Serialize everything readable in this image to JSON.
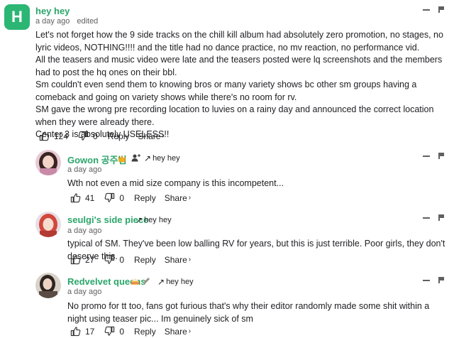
{
  "colors": {
    "avatar_green": "#2bb673",
    "author_green": "#2ba66a",
    "muted": "#606060"
  },
  "comments": [
    {
      "avatar_letter": "H",
      "author": "hey hey",
      "time": "a day ago",
      "edited": "edited",
      "paragraphs": [
        "Let's not forget how the 9 side tracks on the chill kill album had absolutely zero promotion, no stages, no lyric videos, NOTHING!!!! and the title had no dance practice, no mv reaction, no performance vid.",
        "All the teasers and music video were late and the teasers posted were lq screenshots and the members had to post the hq ones on their bbl.",
        "Sm couldn't even send them to knowing bros or many variety shows bc other sm groups having a comeback and going on variety shows while there's no room for rv.",
        "SM gave the wrong pre recording location to luvies on a rainy day and announced the correct location when they were already there.",
        "Center 3 is absolutely USELESS!!"
      ],
      "likes": "124",
      "dislikes": "0",
      "reply_label": "Reply",
      "share_label": "Share",
      "share_chevron": "›"
    },
    {
      "author": "Gowon 공주님",
      "icons": [
        "crown-icon",
        "person-plus-icon"
      ],
      "reply_to": "hey hey",
      "time": "a day ago",
      "text": "Wth not even a mid size company is this incompetent...",
      "likes": "41",
      "dislikes": "0",
      "reply_label": "Reply",
      "share_label": "Share",
      "share_chevron": "›"
    },
    {
      "author": "seulgi's side piece",
      "reply_to": "hey hey",
      "time": "a day ago",
      "text": "typical of SM. They've been low balling RV for years, but this is just terrible. Poor girls, they don't deserve this.",
      "likes": "27",
      "dislikes": "0",
      "reply_label": "Reply",
      "share_label": "Share",
      "share_chevron": "›"
    },
    {
      "author": "Redvelvet queens",
      "icons": [
        "cake-icon",
        "pencil-icon"
      ],
      "reply_to": "hey hey",
      "time": "a day ago",
      "text": "No promo for tt too, fans got furious that's why their editor randomly made some shit within a night using teaser pic... Im genuinely sick of sm",
      "likes": "17",
      "dislikes": "0",
      "reply_label": "Reply",
      "share_label": "Share",
      "share_chevron": "›"
    }
  ]
}
